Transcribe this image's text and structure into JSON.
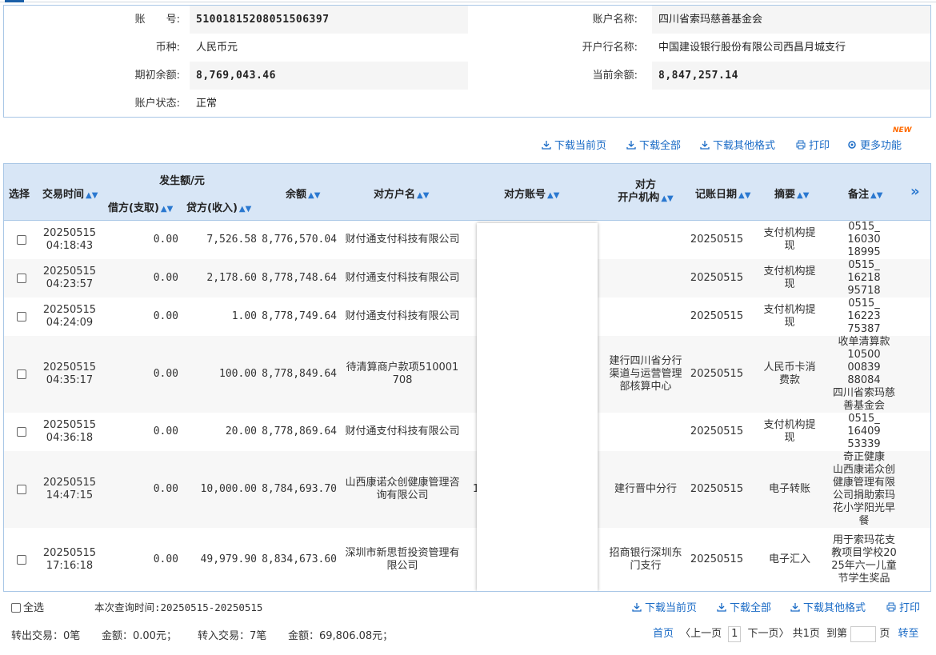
{
  "account": {
    "account_no_label": "账　　号:",
    "account_no": "51001815208051506397",
    "account_name_label": "账户名称:",
    "account_name": "四川省索玛慈善基金会",
    "currency_label": "币种:",
    "currency": "人民币元",
    "bank_label": "开户行名称:",
    "bank": "中国建设银行股份有限公司西昌月城支行",
    "opening_balance_label": "期初余额:",
    "opening_balance": "8,769,043.46",
    "current_balance_label": "当前余额:",
    "current_balance": "8,847,257.14",
    "status_label": "账户状态:",
    "status": "正常"
  },
  "toolbar": {
    "download_current": "下载当前页",
    "download_all": "下载全部",
    "download_other": "下载其他格式",
    "print": "打印",
    "more": "更多功能",
    "new_badge": "NEW"
  },
  "table": {
    "headers": {
      "select": "选择",
      "time": "交易时间",
      "amount_group": "发生额/元",
      "debit": "借方(支取)",
      "credit": "贷方(收入)",
      "balance": "余额",
      "counterparty_name": "对方户名",
      "counterparty_account": "对方账号",
      "counterparty_bank_line1": "对方",
      "counterparty_bank_line2": "开户机构",
      "post_date": "记账日期",
      "summary": "摘要",
      "remark": "备注",
      "more": "»"
    },
    "rows": [
      {
        "date": "20250515",
        "time": "04:18:43",
        "debit": "0.00",
        "credit": "7,526.58",
        "balance": "8,776,570.04",
        "name": "财付通支付科技有限公司",
        "account": "",
        "bank": "",
        "post_date": "20250515",
        "summary": "支付机构提现",
        "remark": "0515_\n16030\n18995"
      },
      {
        "date": "20250515",
        "time": "04:23:57",
        "debit": "0.00",
        "credit": "2,178.60",
        "balance": "8,778,748.64",
        "name": "财付通支付科技有限公司",
        "account": "",
        "bank": "",
        "post_date": "20250515",
        "summary": "支付机构提现",
        "remark": "0515_\n16218\n95718"
      },
      {
        "date": "20250515",
        "time": "04:24:09",
        "debit": "0.00",
        "credit": "1.00",
        "balance": "8,778,749.64",
        "name": "财付通支付科技有限公司",
        "account": "",
        "bank": "",
        "post_date": "20250515",
        "summary": "支付机构提现",
        "remark": "0515_\n16223\n75387"
      },
      {
        "date": "20250515",
        "time": "04:35:17",
        "debit": "0.00",
        "credit": "100.00",
        "balance": "8,778,849.64",
        "name": "待清算商户款项510001708",
        "account": "",
        "bank": "建行四川省分行渠道与运营管理部核算中心",
        "post_date": "20250515",
        "summary": "人民币卡消费款",
        "remark": "收单清算款\n10500\n00839\n88084\n四川省索玛慈善基金会"
      },
      {
        "date": "20250515",
        "time": "04:36:18",
        "debit": "0.00",
        "credit": "20.00",
        "balance": "8,778,869.64",
        "name": "财付通支付科技有限公司",
        "account": "",
        "bank": "",
        "post_date": "20250515",
        "summary": "支付机构提现",
        "remark": "0515_\n16409\n53339"
      },
      {
        "date": "20250515",
        "time": "14:47:15",
        "debit": "0.00",
        "credit": "10,000.00",
        "balance": "8,784,693.70",
        "name": "山西康诺众创健康管理咨询有限公司",
        "account": "1",
        "bank": "建行晋中分行",
        "post_date": "20250515",
        "summary": "电子转账",
        "remark": "奇正健康\n山西康诺众创健康管理有限公司捐助索玛花小学阳光早餐"
      },
      {
        "date": "20250515",
        "time": "17:16:18",
        "debit": "0.00",
        "credit": "49,979.90",
        "balance": "8,834,673.60",
        "name": "深圳市新思哲投资管理有限公司",
        "account": "",
        "bank": "招商银行深圳东门支行",
        "post_date": "20250515",
        "summary": "电子汇入",
        "remark": "用于索玛花支教项目学校2025年六一儿童节学生奖品"
      }
    ]
  },
  "footer": {
    "select_all": "全选",
    "query_time": "本次查询时间:20250515-20250515",
    "download_current": "下载当前页",
    "download_all": "下载全部",
    "download_other": "下载其他格式",
    "print": "打印",
    "out_tx": "转出交易：0笔",
    "out_amount": "金额：0.00元；",
    "in_tx": "转入交易：7笔",
    "in_amount": "金额：69,806.08元；",
    "first_page": "首页",
    "prev_page": "〈上一页",
    "current_page": "1",
    "next_page": "下一页〉",
    "total_pages": "共1页",
    "goto_label": "到第",
    "page_unit": "页",
    "go": "转至"
  }
}
